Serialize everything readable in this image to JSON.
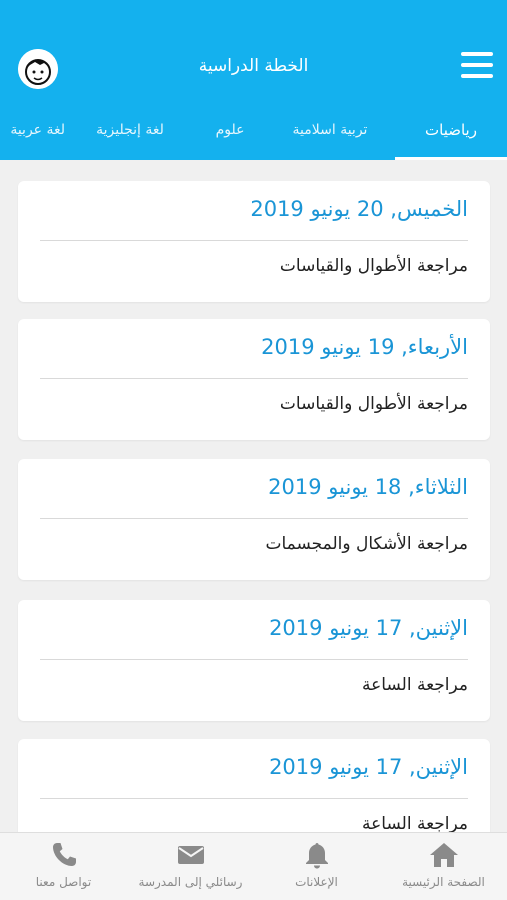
{
  "header": {
    "title": "الخطة الدراسية",
    "menu_icon": "hamburger-menu-icon",
    "avatar_icon": "user-avatar-icon"
  },
  "tabs": [
    {
      "label": "رياضيات",
      "active": true
    },
    {
      "label": "تربية اسلامية",
      "active": false
    },
    {
      "label": "علوم",
      "active": false
    },
    {
      "label": "لغة إنجليزية",
      "active": false
    },
    {
      "label": "لغة عربية",
      "active": false
    }
  ],
  "cards": [
    {
      "date": "الخميس, 20 يونيو 2019",
      "topic": "مراجعة الأطوال والقياسات"
    },
    {
      "date": "الأربعاء, 19 يونيو 2019",
      "topic": "مراجعة الأطوال والقياسات"
    },
    {
      "date": "الثلاثاء, 18 يونيو 2019",
      "topic": "مراجعة الأشكال والمجسمات"
    },
    {
      "date": "الإثنين, 17 يونيو 2019",
      "topic": "مراجعة الساعة"
    },
    {
      "date": "الإثنين, 17 يونيو 2019",
      "topic": "مراجعة الساعة"
    }
  ],
  "bottom_nav": [
    {
      "label": "الصفحة الرئيسية",
      "icon": "home-icon"
    },
    {
      "label": "الإعلانات",
      "icon": "bell-icon"
    },
    {
      "label": "رسائلي إلى المدرسة",
      "icon": "envelope-icon"
    },
    {
      "label": "تواصل معنا",
      "icon": "phone-icon"
    }
  ],
  "colors": {
    "header_bg": "#14b1ee",
    "date_text": "#1a95d6",
    "nav_icon": "#8a8a8a"
  }
}
